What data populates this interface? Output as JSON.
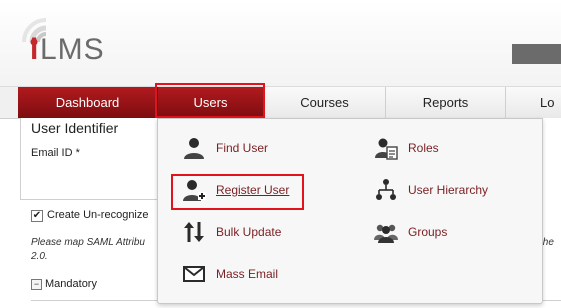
{
  "app": {
    "logo_text": "LMS",
    "logo_i": "i"
  },
  "nav": {
    "tabs": [
      {
        "label": "Dashboard",
        "active": false,
        "highlight": "red"
      },
      {
        "label": "Users",
        "active": true,
        "highlight": "red"
      },
      {
        "label": "Courses"
      },
      {
        "label": "Reports"
      },
      {
        "label": "Lo"
      }
    ]
  },
  "form": {
    "section_title": "User Identifier",
    "email_label": "Email ID *",
    "create_checkbox_label": "Create Un-recognize",
    "create_checkbox_checked": true,
    "saml_note": "Please map SAML Attribu",
    "saml_note_line2": "2.0.",
    "saml_note_right": "the",
    "mandatory_label": "Mandatory"
  },
  "users_menu": {
    "items": [
      {
        "label": "Find User",
        "icon": "user-icon"
      },
      {
        "label": "Roles",
        "icon": "user-roles-icon"
      },
      {
        "label": "Register User",
        "icon": "register-user-icon"
      },
      {
        "label": "User Hierarchy",
        "icon": "hierarchy-icon"
      },
      {
        "label": "Bulk Update",
        "icon": "bulk-update-icon"
      },
      {
        "label": "Groups",
        "icon": "groups-icon"
      },
      {
        "label": "Mass Email",
        "icon": "mail-icon"
      }
    ]
  },
  "colors": {
    "brand_red": "#c2282c",
    "active_tab_gradient_top": "#b11a1e",
    "active_tab_gradient_bottom": "#7d0d10",
    "highlight_outline": "#e2131b",
    "menu_text": "#7a1f22"
  }
}
